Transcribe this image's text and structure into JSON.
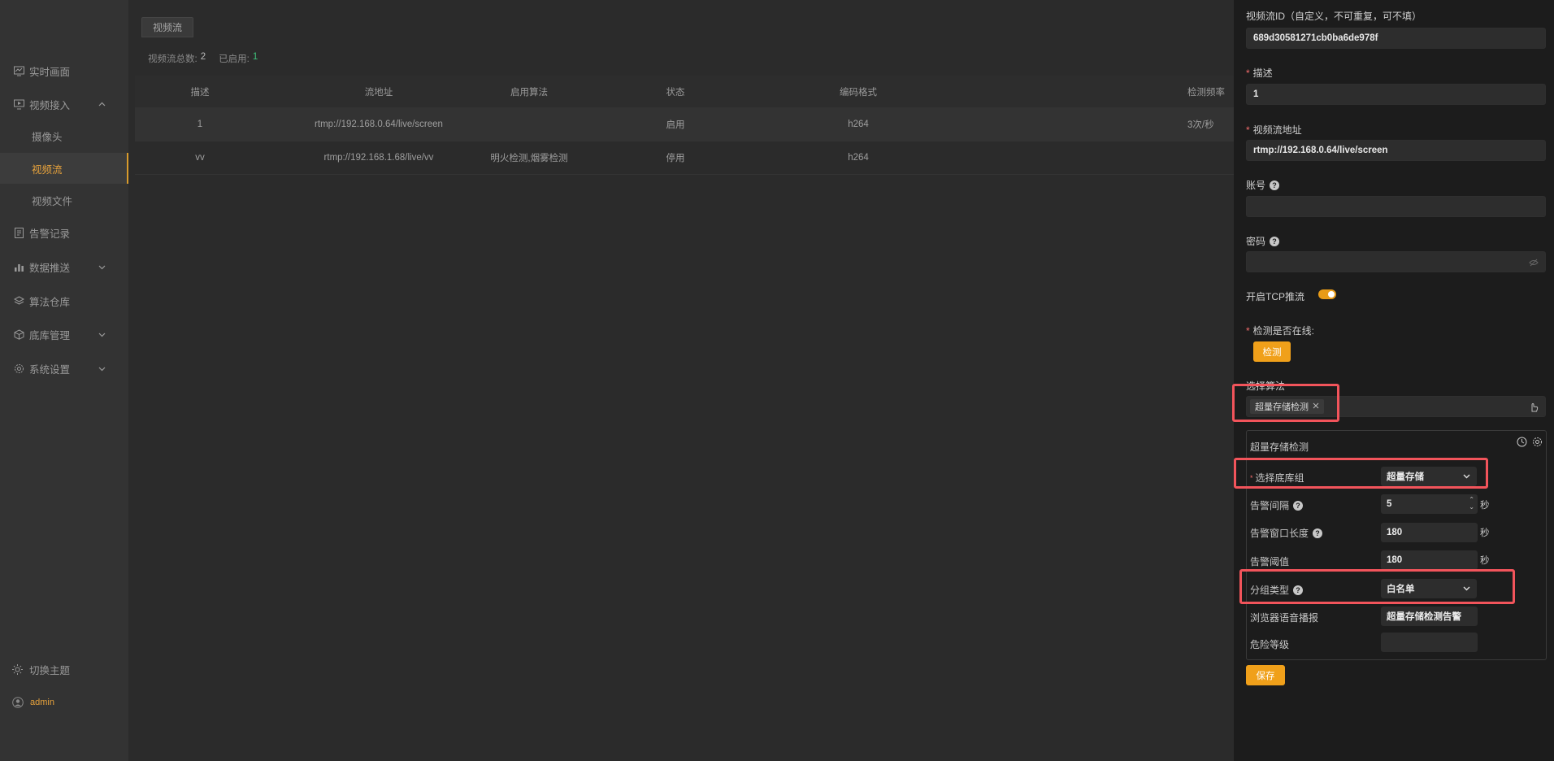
{
  "sidebar": {
    "items": [
      {
        "label": "实时画面",
        "icon": "monitor-chart-icon"
      },
      {
        "label": "视频接入",
        "icon": "video-input-icon",
        "expanded": true
      },
      {
        "label": "告警记录",
        "icon": "alarm-record-icon"
      },
      {
        "label": "数据推送",
        "icon": "data-push-icon"
      },
      {
        "label": "算法仓库",
        "icon": "algorithm-icon"
      },
      {
        "label": "底库管理",
        "icon": "cube-icon"
      },
      {
        "label": "系统设置",
        "icon": "gear-icon"
      }
    ],
    "sub_items": [
      {
        "label": "摄像头"
      },
      {
        "label": "视频流",
        "active": true
      },
      {
        "label": "视频文件"
      }
    ],
    "theme_label": "切换主题",
    "user_label": "admin"
  },
  "main": {
    "tab_label": "视频流",
    "stats": {
      "total_label": "视频流总数:",
      "total_value": "2",
      "enabled_label": "已启用:",
      "enabled_value": "1"
    },
    "table": {
      "headers": [
        "描述",
        "流地址",
        "启用算法",
        "状态",
        "编码格式",
        "检测频率"
      ],
      "rows": [
        [
          "1",
          "rtmp://192.168.0.64/live/screen",
          "",
          "启用",
          "h264",
          "3次/秒"
        ],
        [
          "vv",
          "rtmp://192.168.1.68/live/vv",
          "明火检测,烟雾检测",
          "停用",
          "h264",
          ""
        ]
      ]
    }
  },
  "panel": {
    "stream_id_label": "视频流ID（自定义，不可重复，可不填）",
    "stream_id_value": "689d30581271cb0ba6de978f",
    "desc_label": "描述",
    "desc_value": "1",
    "url_label": "视频流地址",
    "url_value": "rtmp://192.168.0.64/live/screen",
    "account_label": "账号",
    "account_value": "",
    "password_label": "密码",
    "password_value": "",
    "tcp_label": "开启TCP推流",
    "tcp_enabled": true,
    "online_label": "检测是否在线:",
    "detect_button": "检测",
    "algo_label": "选择算法",
    "algo_tag": "超量存储检测",
    "algo_section_title": "超量存储检测",
    "fields": {
      "group_label": "选择底库组",
      "group_value": "超量存储",
      "interval_label": "告警间隔",
      "interval_value": "5",
      "window_label": "告警窗口长度",
      "window_value": "180",
      "threshold_label": "告警阈值",
      "threshold_value": "180",
      "group_type_label": "分组类型",
      "group_type_value": "白名单",
      "voice_label": "浏览器语音播报",
      "voice_value": "超量存储检测告警",
      "danger_label": "危险等级",
      "danger_value": "",
      "unit": "秒"
    },
    "save_button": "保存"
  }
}
